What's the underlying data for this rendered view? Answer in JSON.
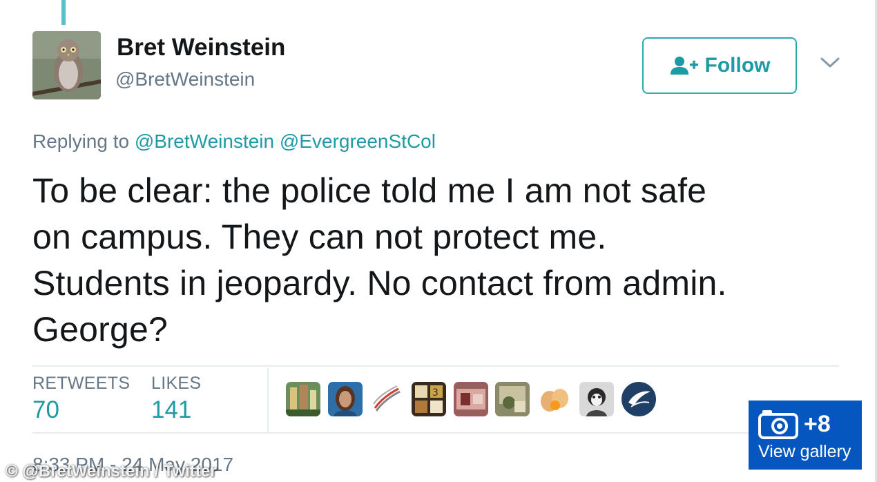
{
  "author": {
    "display_name": "Bret Weinstein",
    "handle": "@BretWeinstein",
    "avatar_icon": "owl-photo-avatar"
  },
  "follow_button": {
    "label": "Follow",
    "icon": "add-user-icon"
  },
  "menu_icon": "chevron-down-icon",
  "reply": {
    "prefix": "Replying to",
    "mentions": [
      "@BretWeinstein",
      "@EvergreenStCol"
    ]
  },
  "tweet": {
    "lines": [
      "To be clear: the police told me I am not safe",
      "on campus. They can not protect me.",
      "Students in jeopardy. No contact from admin.",
      "George?"
    ]
  },
  "stats": {
    "retweets_label": "RETWEETS",
    "retweets_value": "70",
    "likes_label": "LIKES",
    "likes_value": "141"
  },
  "likers": [
    {
      "name": "liker-avatar-1"
    },
    {
      "name": "liker-avatar-2"
    },
    {
      "name": "liker-avatar-3"
    },
    {
      "name": "liker-avatar-4"
    },
    {
      "name": "liker-avatar-5"
    },
    {
      "name": "liker-avatar-6"
    },
    {
      "name": "liker-avatar-7"
    },
    {
      "name": "liker-avatar-8"
    },
    {
      "name": "liker-avatar-9"
    }
  ],
  "timestamp": "8:33 PM - 24 May 2017",
  "image_credit": "© @BretWeinstein / Twitter",
  "gallery": {
    "count": "+8",
    "label": "View gallery",
    "icon": "camera-icon"
  },
  "colors": {
    "accent": "#1d9aa4",
    "secondary_text": "#657786",
    "gallery_blue": "#0556bf"
  }
}
